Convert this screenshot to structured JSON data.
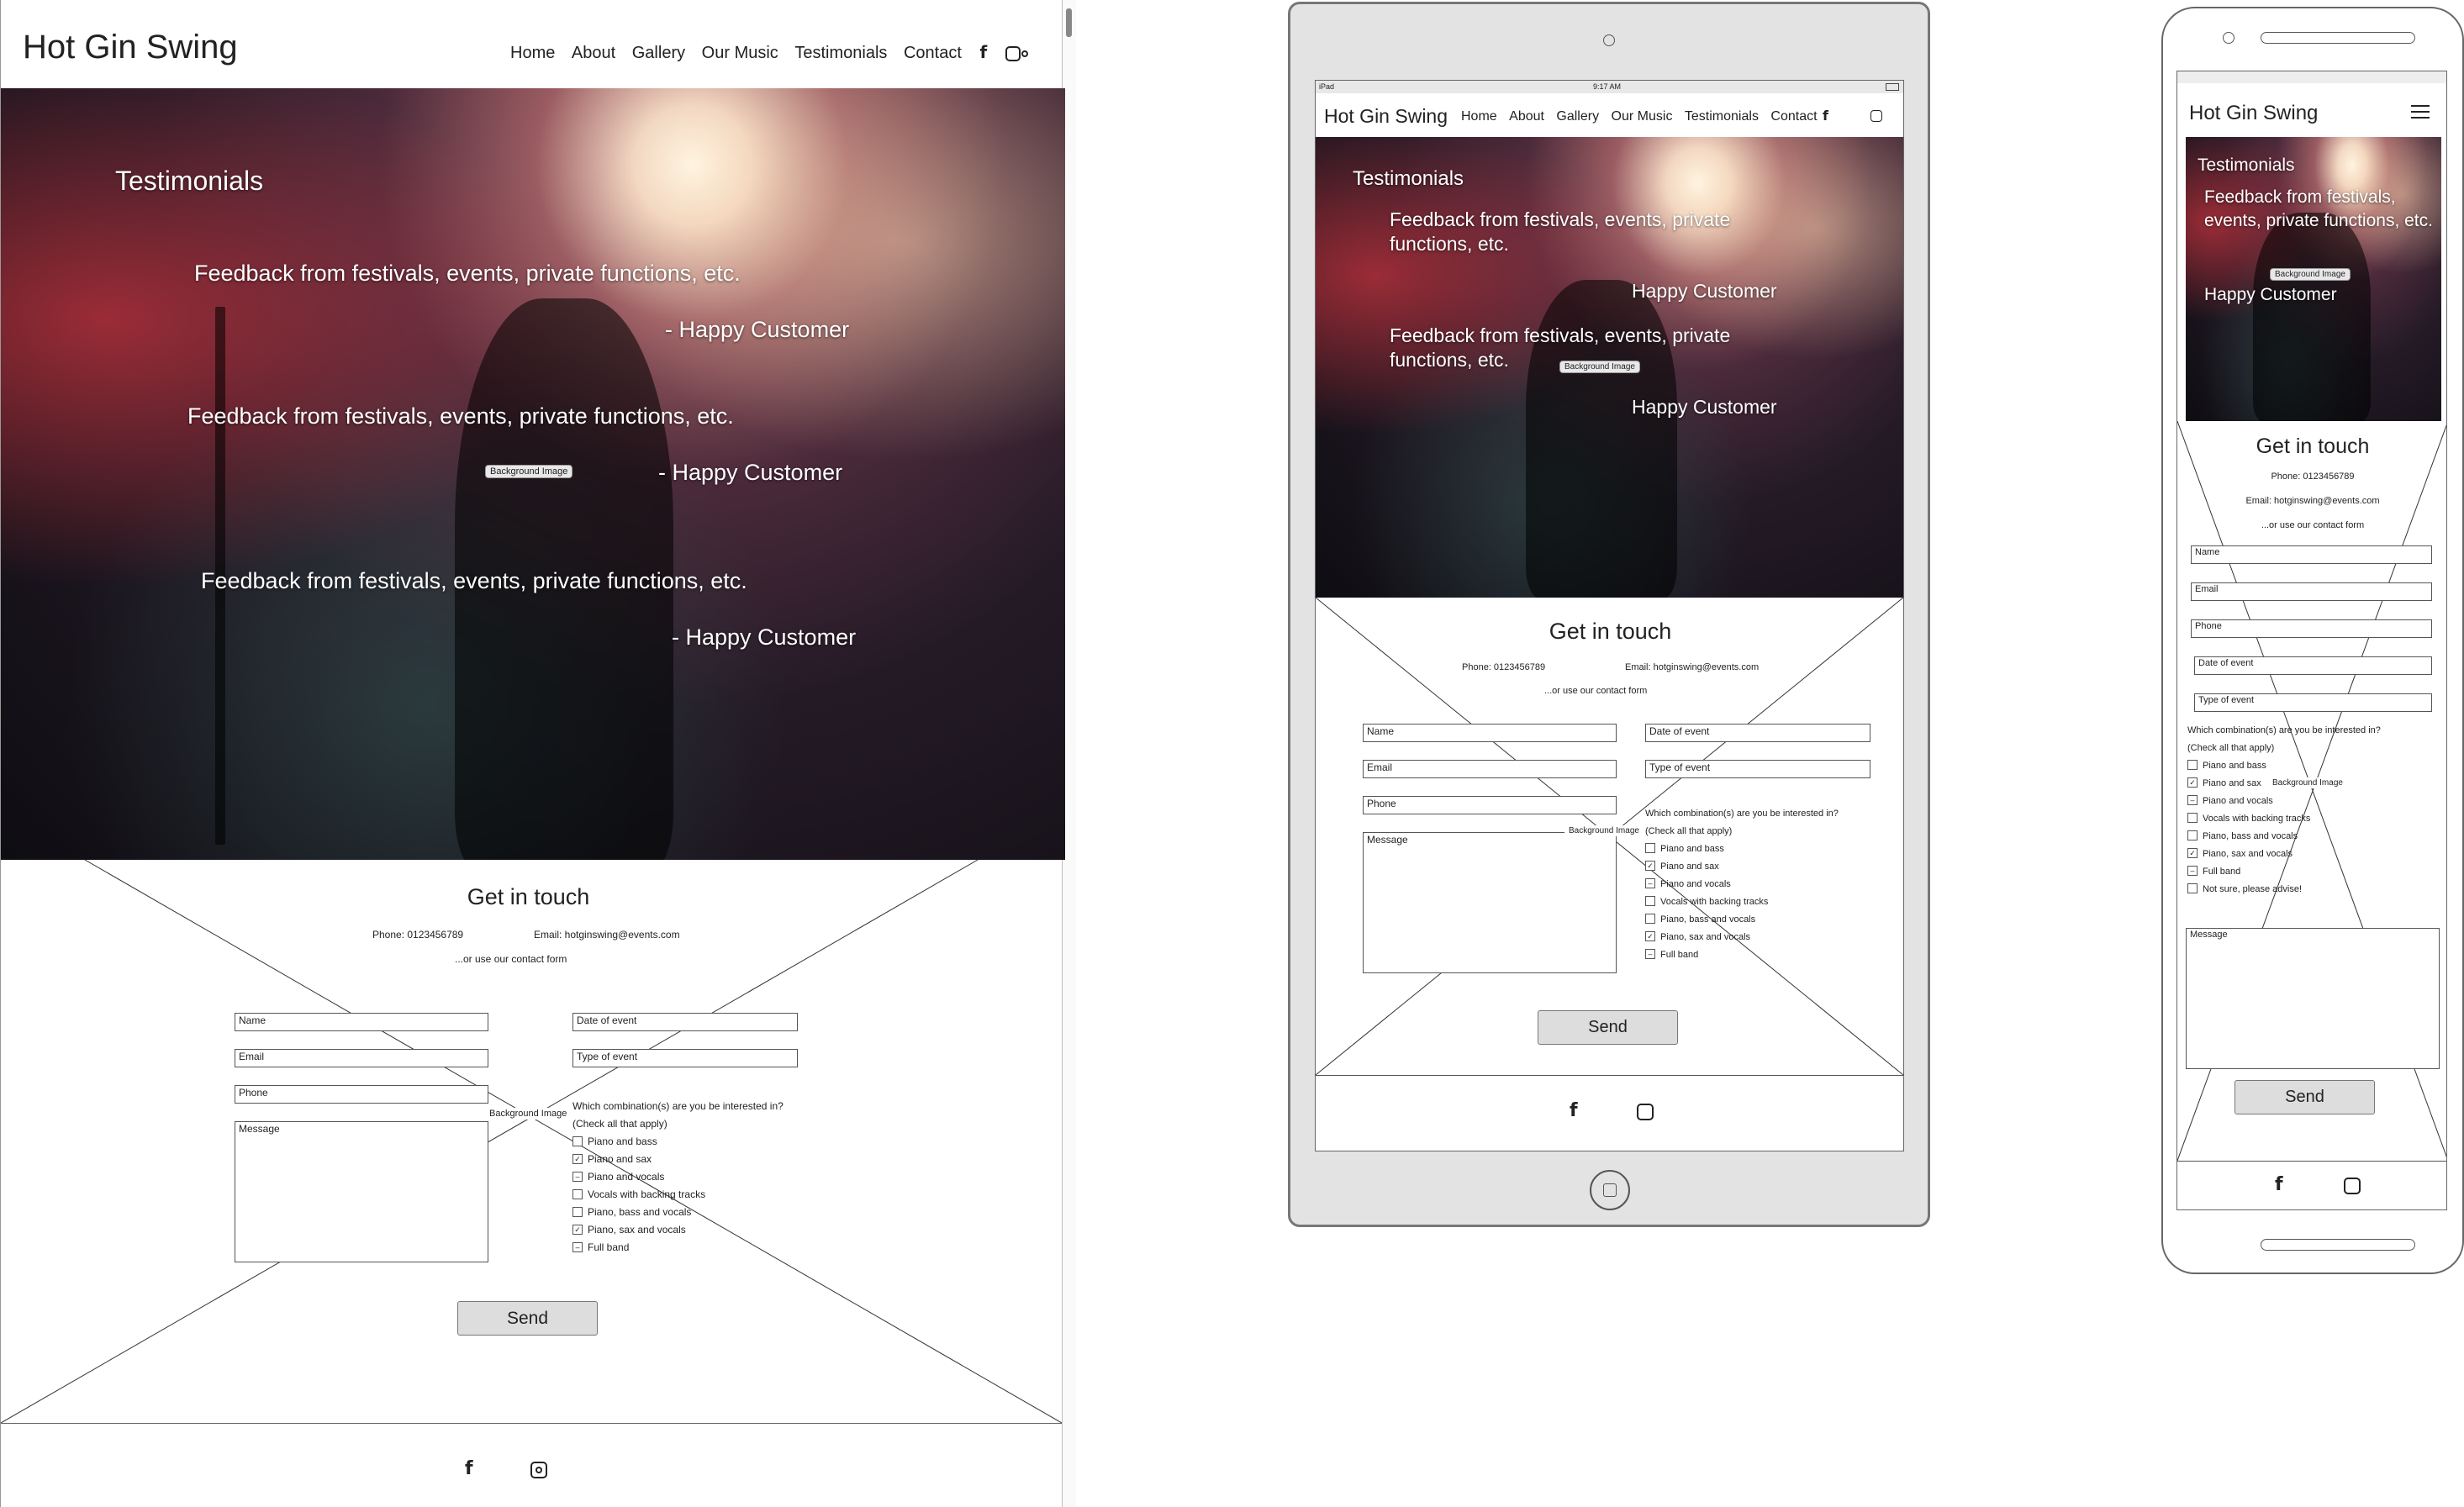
{
  "site": {
    "brand": "Hot Gin Swing"
  },
  "nav": {
    "home": "Home",
    "about": "About",
    "gallery": "Gallery",
    "music": "Our Music",
    "testimonials": "Testimonials",
    "contact": "Contact"
  },
  "icons": {
    "facebook": "facebook-icon",
    "instagram": "instagram-icon",
    "menu": "hamburger-menu-icon"
  },
  "hero": {
    "heading": "Testimonials",
    "feedback": "Feedback from festivals, events, private functions, etc.",
    "author_dash": "- Happy Customer",
    "author": "Happy Customer",
    "bg_label": "Background Image"
  },
  "contact": {
    "heading": "Get in touch",
    "phone": "Phone: 0123456789",
    "email": "Email: hotginswing@events.com",
    "alt": "...or use our contact form",
    "name": "Name",
    "email_field": "Email",
    "phone_field": "Phone",
    "date": "Date of event",
    "type": "Type of event",
    "message": "Message",
    "question": "Which combination(s) are you be interested in?",
    "hint": "(Check all that apply)",
    "send": "Send",
    "options": [
      "Piano and bass",
      "Piano and sax",
      "Piano and vocals",
      "Vocals with backing tracks",
      "Piano, bass and vocals",
      "Piano, sax and vocals",
      "Full band",
      "Not sure, please advise!"
    ]
  },
  "tablet_status": {
    "left": "iPad",
    "time": "9:17 AM"
  }
}
